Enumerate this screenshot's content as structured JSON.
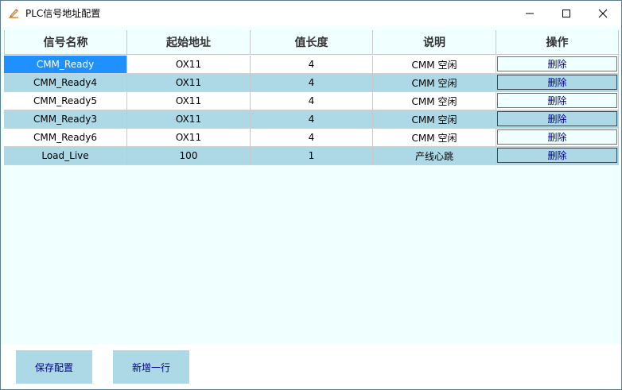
{
  "window": {
    "title": "PLC信号地址配置",
    "icon": "pencil-edit-icon"
  },
  "table": {
    "columns": [
      "信号名称",
      "起始地址",
      "值长度",
      "说明",
      "操作"
    ],
    "rows": [
      {
        "name": "CMM_Ready",
        "address": "OX11",
        "length": "4",
        "desc": "CMM 空闲",
        "action": "删除",
        "selected": true
      },
      {
        "name": "CMM_Ready4",
        "address": "OX11",
        "length": "4",
        "desc": "CMM 空闲",
        "action": "删除"
      },
      {
        "name": "CMM_Ready5",
        "address": "OX11",
        "length": "4",
        "desc": "CMM 空闲",
        "action": "删除"
      },
      {
        "name": "CMM_Ready3",
        "address": "OX11",
        "length": "4",
        "desc": "CMM 空闲",
        "action": "删除"
      },
      {
        "name": "CMM_Ready6",
        "address": "OX11",
        "length": "4",
        "desc": "CMM 空闲",
        "action": "删除"
      },
      {
        "name": "Load_Live",
        "address": "100",
        "length": "1",
        "desc": "产线心跳",
        "action": "删除"
      }
    ]
  },
  "footer": {
    "save_label": "保存配置",
    "add_row_label": "新增一行"
  },
  "colors": {
    "row_alt": "#add8e6",
    "row_plain": "#ffffff",
    "selection": "#1e90ff",
    "background": "#f0ffff",
    "button_text": "#00008b"
  }
}
